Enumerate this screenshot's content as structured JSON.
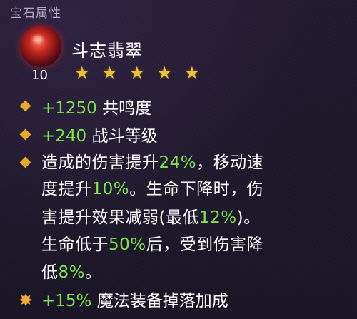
{
  "header": {
    "title": "宝石属性"
  },
  "gem": {
    "name": "斗志翡翠",
    "level": "10",
    "stars": 5,
    "star_glyph": "★"
  },
  "stats": [
    {
      "prefix": "+1250",
      "label": " 共鸣度"
    },
    {
      "prefix": "+240",
      "label": " 战斗等级"
    }
  ],
  "effect": {
    "l1a": "造成的伤害提升",
    "l1b": "24%",
    "l1c": "，移动速",
    "l2a": "度提升",
    "l2b": "10%",
    "l2c": "。生命下降时，伤",
    "l3a": "害提升效果减弱(最低",
    "l3b": "12%",
    "l3c": ")。",
    "l4a": "生命低于",
    "l4b": "50%",
    "l4c": "后，受到伤害降",
    "l5a": "低",
    "l5b": "8%",
    "l5c": "。"
  },
  "bonus": {
    "prefix": "+15%",
    "label": " 魔法装备掉落加成"
  },
  "colors": {
    "accent_green": "#7ee349",
    "bullet_gold": "#e5a92c",
    "star_gold": "#e7c13e"
  }
}
